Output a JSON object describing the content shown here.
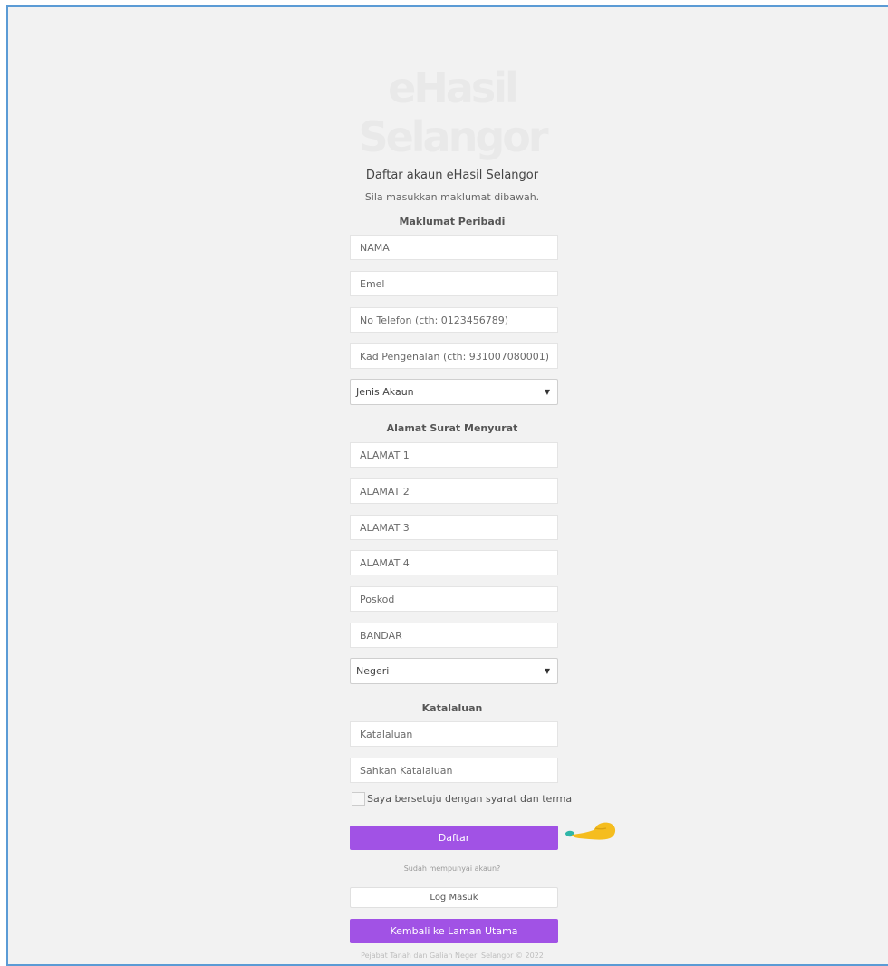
{
  "logo": {
    "line1": "eHasil",
    "line2": "Selangor"
  },
  "header": {
    "title": "Daftar akaun eHasil Selangor",
    "subtitle": "Sila masukkan maklumat dibawah."
  },
  "sections": {
    "personal": "Maklumat Peribadi",
    "address": "Alamat Surat Menyurat",
    "password": "Katalaluan"
  },
  "fields": {
    "nama": "NAMA",
    "emel": "Emel",
    "telefon": "No Telefon (cth: 0123456789)",
    "kad_pengenalan": "Kad Pengenalan (cth: 931007080001)",
    "jenis_akaun": "Jenis Akaun",
    "alamat1": "ALAMAT 1",
    "alamat2": "ALAMAT 2",
    "alamat3": "ALAMAT 3",
    "alamat4": "ALAMAT 4",
    "poskod": "Poskod",
    "bandar": "BANDAR",
    "negeri": "Negeri",
    "katalaluan": "Katalaluan",
    "sahkan_katalaluan": "Sahkan Katalaluan"
  },
  "agree": {
    "label": "Saya bersetuju dengan syarat dan terma"
  },
  "buttons": {
    "daftar": "Daftar",
    "log_masuk": "Log Masuk",
    "kembali": "Kembali ke Laman Utama"
  },
  "links": {
    "sudah_ada_akaun": "Sudah mempunyai akaun?"
  },
  "footer": {
    "text": "Pejabat Tanah dan Galian Negeri Selangor © 2022"
  },
  "colors": {
    "accent": "#a152e5",
    "frame_border": "#5b9bd5",
    "pointer": "#f5bd1f"
  }
}
